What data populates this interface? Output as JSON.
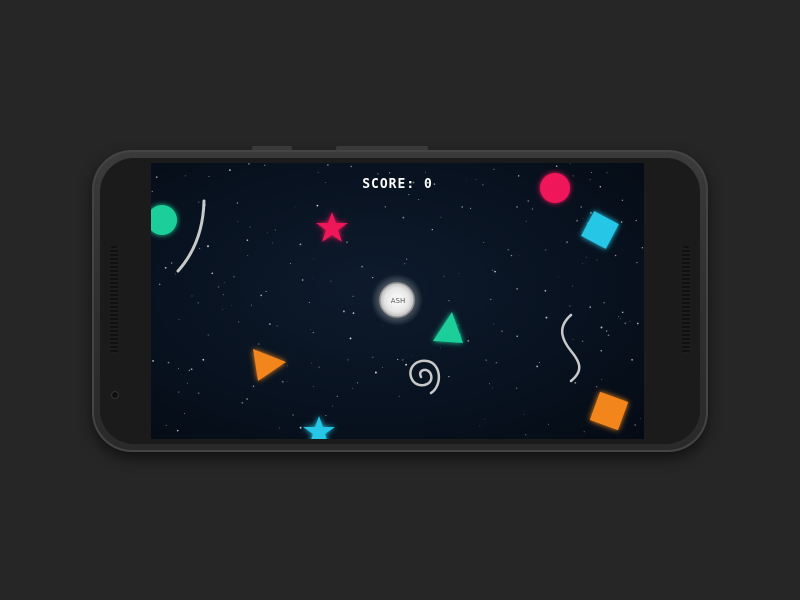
{
  "game": {
    "score_label": "SCORE:",
    "score_value": "0",
    "player_label": "ASH"
  },
  "colors": {
    "pink": "#f0145a",
    "teal": "#1fce9a",
    "cyan": "#25c6e6",
    "orange": "#f2861c",
    "trail": "#c9c9c9",
    "space": "#081220"
  },
  "shapes": [
    {
      "kind": "circle",
      "color": "pink"
    },
    {
      "kind": "circle",
      "color": "teal"
    },
    {
      "kind": "star",
      "color": "pink"
    },
    {
      "kind": "square",
      "color": "cyan"
    },
    {
      "kind": "triangle",
      "color": "teal"
    },
    {
      "kind": "triangle",
      "color": "orange"
    },
    {
      "kind": "star",
      "color": "cyan"
    },
    {
      "kind": "square",
      "color": "orange"
    },
    {
      "kind": "arc-line",
      "color": "trail"
    },
    {
      "kind": "wave-line",
      "color": "trail"
    },
    {
      "kind": "spiral",
      "color": "trail"
    }
  ]
}
